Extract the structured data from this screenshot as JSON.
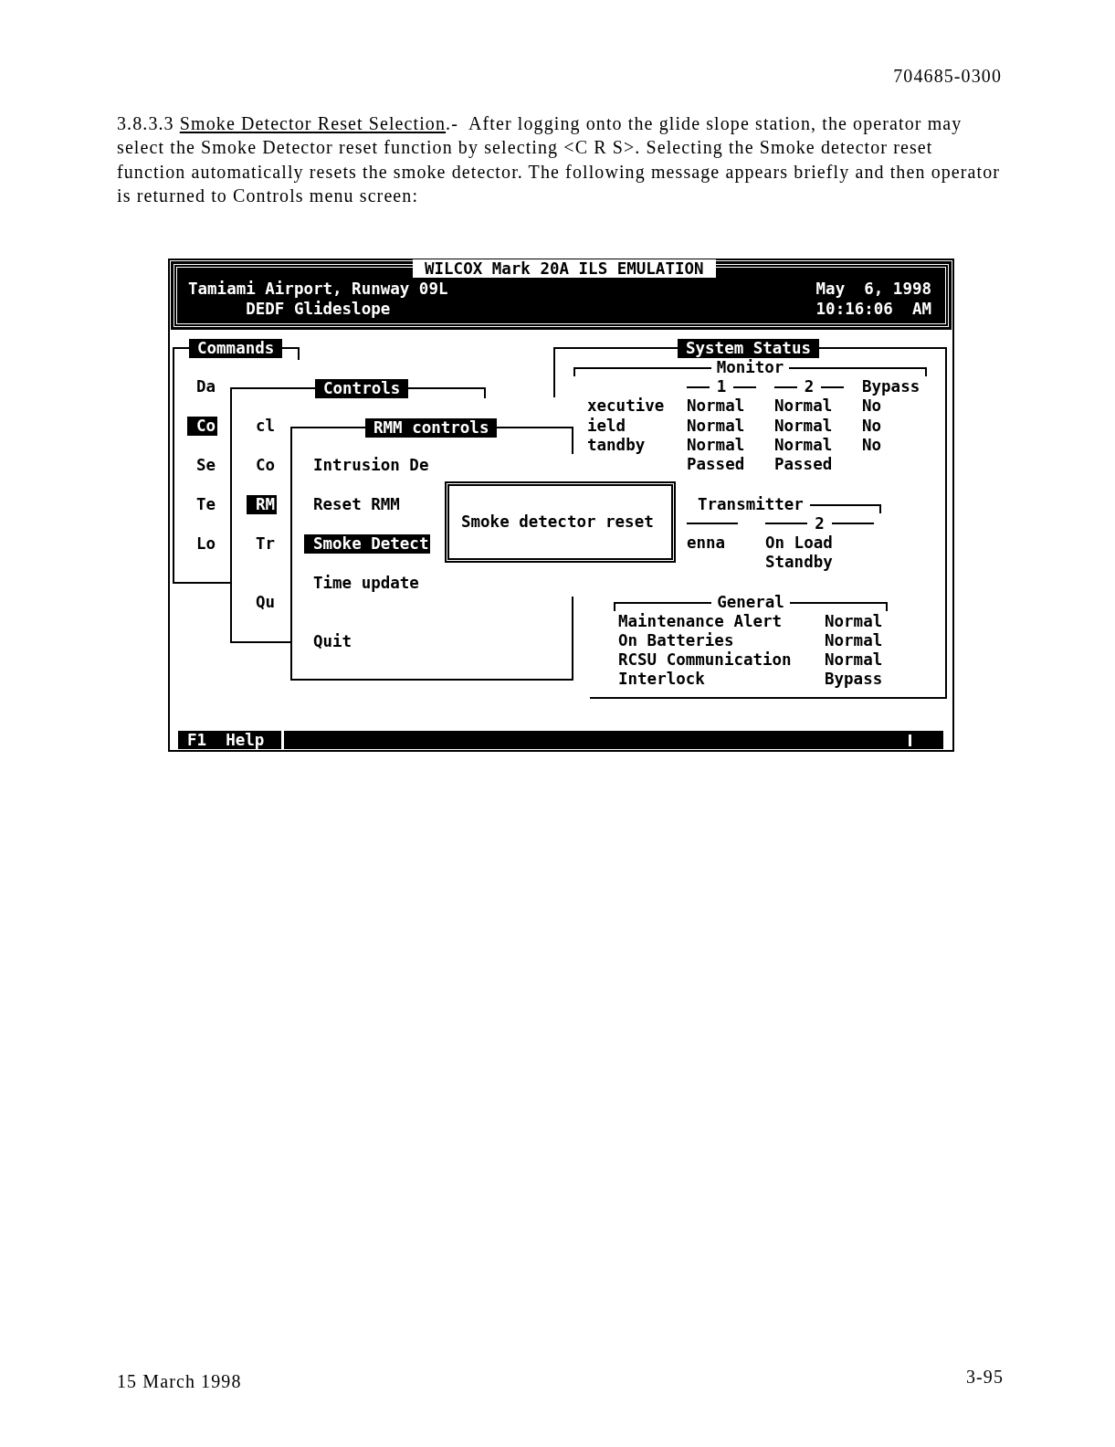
{
  "document_number": "704685-0300",
  "section": {
    "number": "3.8.3.3",
    "heading": "Smoke Detector Reset Selection",
    "lines": [
      ".-  After logging onto the glide slope station, the operator may",
      "select the Smoke Detector reset function by selecting <C R S>. Selecting the Smoke detector reset",
      "function automatically resets the smoke detector. The following message appears briefly and then operator",
      "is returned to Controls menu screen:"
    ]
  },
  "screen": {
    "title": "WILCOX Mark 20A ILS EMULATION",
    "location": "Tamiami Airport, Runway 09L",
    "station": "DEDF Glideslope",
    "date": "May  6, 1998",
    "time": "10:16:06  AM",
    "commands_menu": {
      "title": "Commands",
      "items": [
        {
          "label": "Da",
          "selected": false
        },
        {
          "label": "Co",
          "selected": true
        },
        {
          "label": "Se",
          "selected": false
        },
        {
          "label": "Te",
          "selected": false
        },
        {
          "label": "Lo",
          "selected": false
        }
      ]
    },
    "controls_menu": {
      "title": "Controls",
      "items": [
        {
          "label": "cl",
          "selected": false
        },
        {
          "label": "Co",
          "selected": false
        },
        {
          "label": "RM",
          "selected": true
        },
        {
          "label": "Tr",
          "selected": false
        },
        {
          "label": "Qu",
          "selected": false
        }
      ]
    },
    "rmm_menu": {
      "title": "RMM controls",
      "items": [
        {
          "label": "Intrusion De",
          "selected": false
        },
        {
          "label": "Reset RMM",
          "selected": false
        },
        {
          "label": "Smoke Detect",
          "selected": true
        },
        {
          "label": "Time update",
          "selected": false
        },
        {
          "label": "Quit",
          "selected": false
        }
      ]
    },
    "message": "Smoke detector reset",
    "system_status": {
      "title": "System Status",
      "monitor": {
        "title": "Monitor",
        "columns": [
          {
            "kind": "ruled",
            "label": "1"
          },
          {
            "kind": "ruled",
            "label": "2"
          },
          {
            "kind": "plain",
            "label": "Bypass"
          }
        ],
        "rows": [
          {
            "label": "xecutive",
            "values": [
              "Normal",
              "Normal",
              "No"
            ]
          },
          {
            "label": "ield",
            "values": [
              "Normal",
              "Normal",
              "No"
            ]
          },
          {
            "label": "tandby",
            "values": [
              "Normal",
              "Normal",
              "No"
            ]
          },
          {
            "values": [
              "Passed",
              "Passed"
            ]
          }
        ]
      },
      "transmitter": {
        "title": "Transmitter",
        "columns": [
          {
            "kind": "ruled"
          },
          {
            "kind": "ruled",
            "label": "2"
          }
        ],
        "rows": [
          {
            "label": "enna",
            "values": [
              "On Load"
            ]
          },
          {
            "values": [
              "Standby"
            ]
          }
        ]
      },
      "general": {
        "title": "General",
        "rows": [
          {
            "label": "Maintenance Alert",
            "value": "Normal"
          },
          {
            "label": "On Batteries",
            "value": "Normal"
          },
          {
            "label": "RCSU Communication",
            "value": "Normal"
          },
          {
            "label": "Interlock",
            "value": "Bypass"
          }
        ]
      }
    },
    "status_bar": {
      "hint": "F1  Help"
    }
  },
  "footer": {
    "date": "15 March 1998",
    "page": "3-95"
  }
}
